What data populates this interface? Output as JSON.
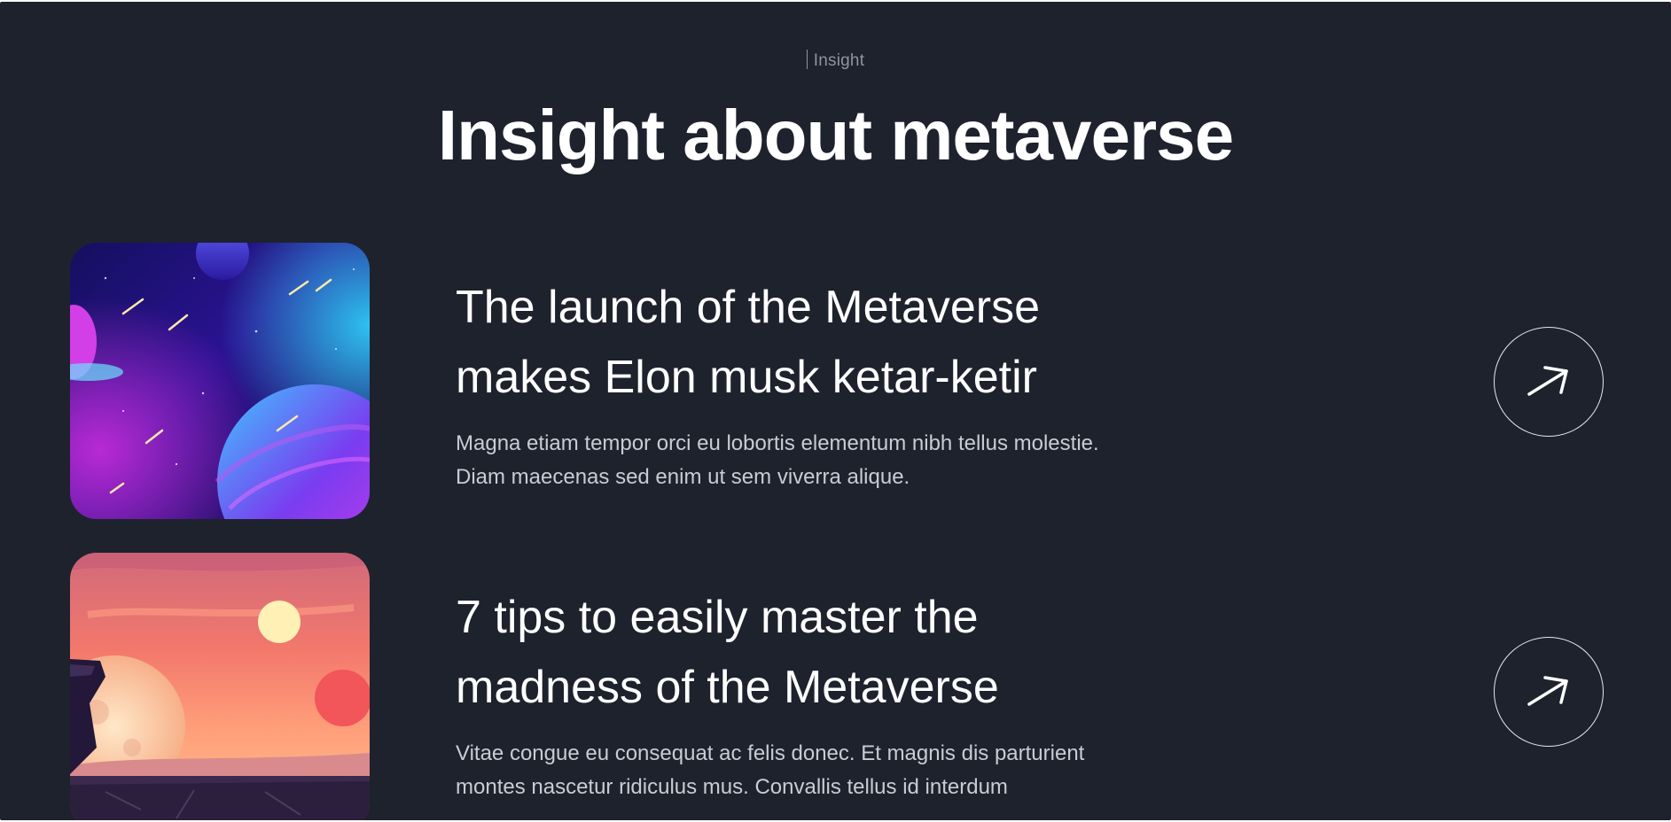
{
  "section": {
    "eyebrow": "Insight",
    "title": "Insight about metaverse"
  },
  "articles": [
    {
      "title_line1": "The launch of the Metaverse",
      "title_line2": "makes Elon musk ketar-ketir",
      "desc_line1": "Magna etiam tempor orci eu lobortis elementum nibh tellus molestie.",
      "desc_line2": "Diam maecenas sed enim ut sem viverra alique.",
      "image": "space-planets-illustration",
      "action_icon": "arrow-up-right-icon"
    },
    {
      "title_line1": "7 tips to easily master the",
      "title_line2": "madness of the Metaverse",
      "desc_line1": "Vitae congue eu consequat ac felis donec. Et magnis dis parturient",
      "desc_line2": "montes nascetur ridiculus mus. Convallis tellus id interdum",
      "image": "sunset-moons-landscape-illustration",
      "action_icon": "arrow-up-right-icon"
    }
  ],
  "colors": {
    "background": "#1d222d",
    "heading": "#ffffff",
    "muted": "#8e94a0",
    "body_text": "#c9ccd2"
  }
}
